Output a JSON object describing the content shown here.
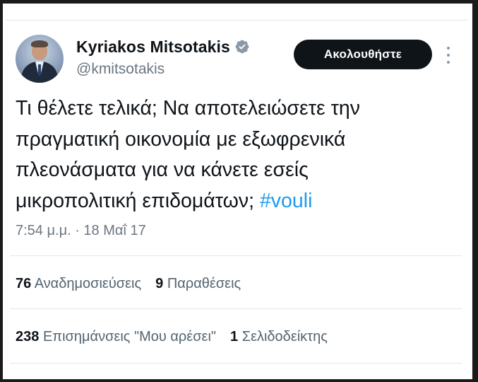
{
  "author": {
    "display_name": "Kyriakos Mitsotakis",
    "handle": "@kmitsotakis",
    "verified": true
  },
  "follow_button_label": "Ακολουθήστε",
  "tweet": {
    "lines": [
      "Τι θέλετε τελικά; Να αποτελειώσετε την",
      "πραγματική οικονομία με εξωφρενικά",
      "πλεονάσματα για να κάνετε εσείς",
      "μικροπολιτική επιδομάτων;"
    ],
    "hashtag": "#vouli",
    "timestamp": "7:54 μ.μ. · 18 Μαΐ 17"
  },
  "stats": {
    "reposts": {
      "count": "76",
      "label": "Αναδημοσιεύσεις"
    },
    "quotes": {
      "count": "9",
      "label": "Παραθέσεις"
    },
    "likes": {
      "count": "238",
      "label": "Επισημάνσεις \"Μου αρέσει\""
    },
    "bookmarks": {
      "count": "1",
      "label": "Σελιδοδείκτης"
    }
  },
  "colors": {
    "text_primary": "#0f1419",
    "text_secondary": "#536471",
    "hashtag": "#1d9bf0",
    "verified_badge": "#8b98a5",
    "button_bg": "#0f1419"
  },
  "icons": {
    "verified": "verified-badge-icon",
    "more": "more-options-icon"
  }
}
